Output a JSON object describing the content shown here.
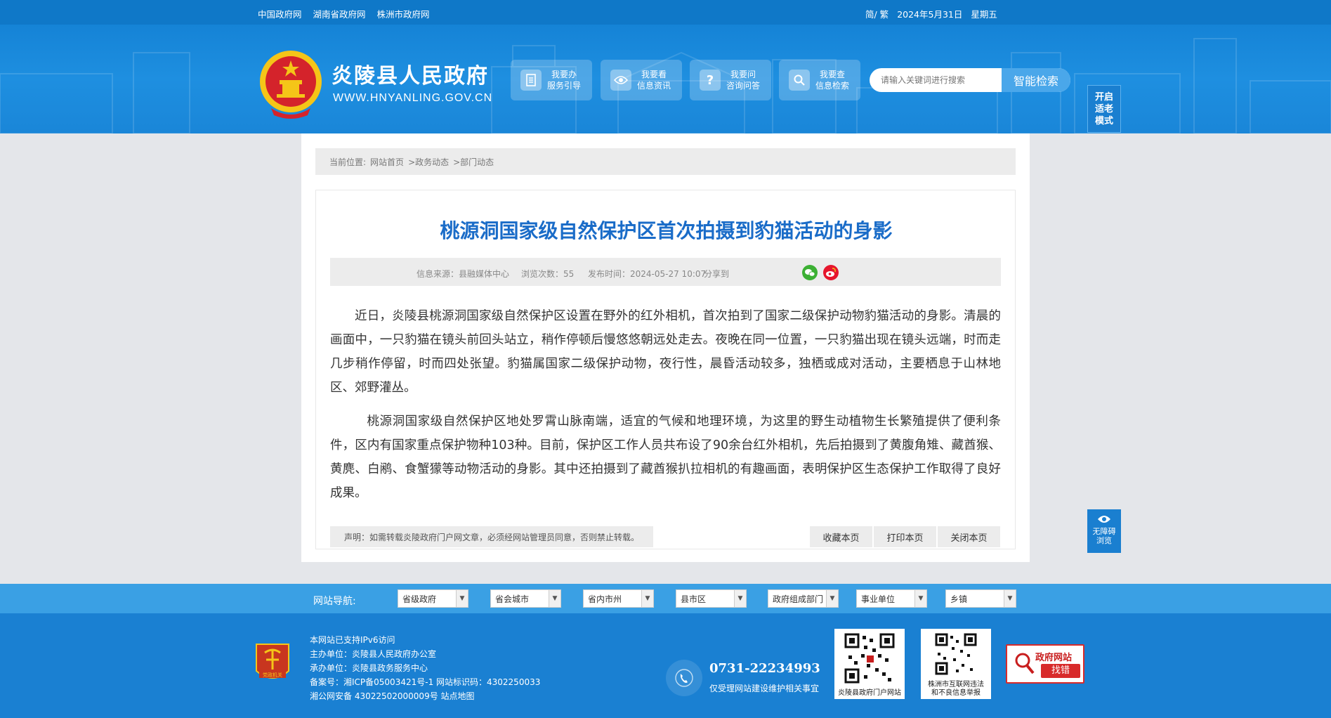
{
  "topbar": {
    "links": [
      "中国政府网",
      "湖南省政府网",
      "株洲市政府网"
    ],
    "lang": "简/ 繁",
    "date": "2024年5月31日",
    "weekday": "星期五"
  },
  "header": {
    "site_name": "炎陵县人民政府",
    "site_domain": "WWW.HNYANLING.GOV.CN",
    "services": [
      {
        "line1": "我要办",
        "line2": "服务引导",
        "icon": "document-icon"
      },
      {
        "line1": "我要看",
        "line2": "信息资讯",
        "icon": "eye-icon"
      },
      {
        "line1": "我要问",
        "line2": "咨询问答",
        "icon": "question-icon"
      },
      {
        "line1": "我要查",
        "line2": "信息检索",
        "icon": "search-icon"
      }
    ],
    "search_placeholder": "请输入关键词进行搜索",
    "search_button": "智能检索",
    "elder_mode": [
      "开启",
      "适老",
      "模式"
    ]
  },
  "breadcrumb": {
    "label": "当前位置:",
    "items": [
      "网站首页",
      ">政务动态",
      ">部门动态"
    ]
  },
  "article": {
    "title": "桃源洞国家级自然保护区首次拍摄到豹猫活动的身影",
    "source": "信息来源：县融媒体中心",
    "views": "浏览次数：55",
    "published": "发布时间：2024-05-27 10:07",
    "share": "分享到",
    "paragraphs": [
      "近日，炎陵县桃源洞国家级自然保护区设置在野外的红外相机，首次拍到了国家二级保护动物豹猫活动的身影。清晨的画面中，一只豹猫在镜头前回头站立，稍作停顿后慢悠悠朝远处走去。夜晚在同一位置，一只豹猫出现在镜头远端，时而走几步稍作停留，时而四处张望。豹猫属国家二级保护动物，夜行性，晨昏活动较多，独栖或成对活动，主要栖息于山林地区、郊野灌丛。",
      "桃源洞国家级自然保护区地处罗霄山脉南端，适宜的气候和地理环境，为这里的野生动植物生长繁殖提供了便利条件，区内有国家重点保护物种103种。目前，保护区工作人员共布设了90余台红外相机，先后拍摄到了黄腹角雉、藏酋猴、黄麂、白鹇、食蟹獴等动物活动的身影。其中还拍摄到了藏酋猴扒拉相机的有趣画面，表明保护区生态保护工作取得了良好成果。"
    ],
    "notice": "声明：如需转载炎陵政府门户网文章，必须经网站管理员同意，否则禁止转载。",
    "actions": [
      "收藏本页",
      "打印本页",
      "关闭本页"
    ]
  },
  "accessibility": {
    "line1": "无障碍",
    "line2": "浏览"
  },
  "nav": {
    "label": "网站导航:",
    "selects": [
      "省级政府",
      "省会城市",
      "省内市州",
      "县市区",
      "政府组成部门",
      "事业单位",
      "乡镇"
    ]
  },
  "footer": {
    "lines": [
      "本网站已支持IPv6访问",
      "主办单位：炎陵县人民政府办公室",
      "承办单位：炎陵县政务服务中心",
      "备案号：湘ICP备05003421号-1 网站标识码：4302250033",
      "湘公网安备 43022502000009号 站点地图"
    ],
    "badge_text": "党政机关",
    "phone": "0731-22234993",
    "phone_desc": "仅受理网站建设维护相关事宜",
    "qr1_caption": "炎陵县政府门户网站",
    "qr2_caption": [
      "株洲市互联网违法",
      "和不良信息举报"
    ],
    "jiucuo_line1": "政府网站",
    "jiucuo_line2": "找错"
  }
}
